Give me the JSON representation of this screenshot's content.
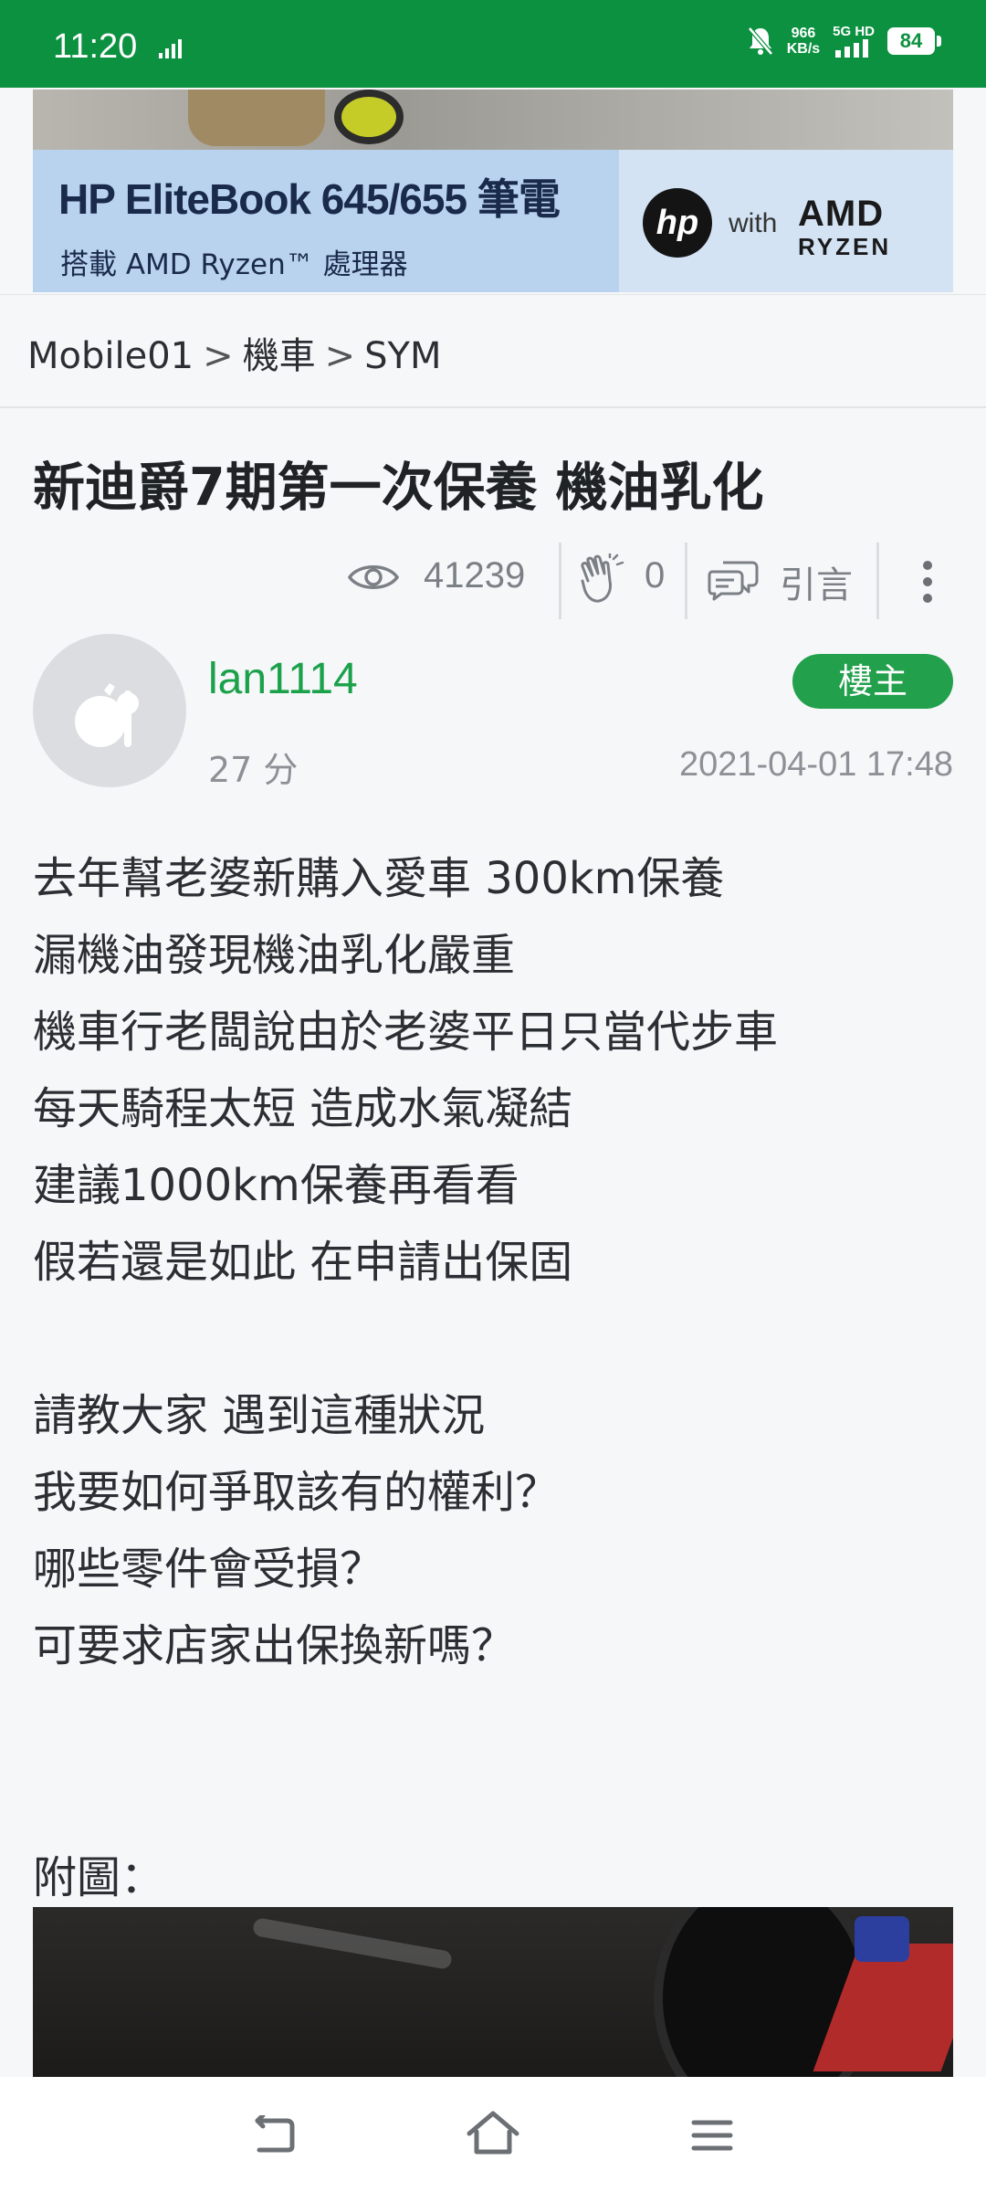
{
  "status_bar": {
    "time": "11:20",
    "net_speed_value": "966",
    "net_speed_unit": "KB/s",
    "network": "5G HD",
    "battery": "84"
  },
  "ad": {
    "title": "HP EliteBook 645/655 筆電",
    "subtitle": "搭載 AMD Ryzen™ 處理器",
    "hp_logo": "hp",
    "with_text": "with",
    "amd": "AMD",
    "ryzen": "RYZEN"
  },
  "breadcrumb": {
    "items": [
      "Mobile01",
      "機車",
      "SYM"
    ],
    "separator": ">"
  },
  "post": {
    "title": "新迪爵7期第一次保養 機油乳化",
    "views": "41239",
    "likes": "0",
    "quote_label": "引言",
    "author": "lan1114",
    "author_score": "27 分",
    "op_badge": "樓主",
    "datetime": "2021-04-01 17:48",
    "body_lines": [
      "去年幫老婆新購入愛車 300km保養",
      "漏機油發現機油乳化嚴重",
      "機車行老闆說由於老婆平日只當代步車",
      "每天騎程太短 造成水氣凝結",
      "建議1000km保養再看看",
      "假若還是如此 在申請出保固",
      "",
      "請教大家 遇到這種狀況",
      "我要如何爭取該有的權利？",
      "哪些零件會受損？",
      "可要求店家出保換新嗎？"
    ],
    "attachment_label": "附圖："
  },
  "colors": {
    "brand_green": "#0c9141",
    "author_green": "#1aa14a",
    "badge_green": "#22a04c"
  }
}
